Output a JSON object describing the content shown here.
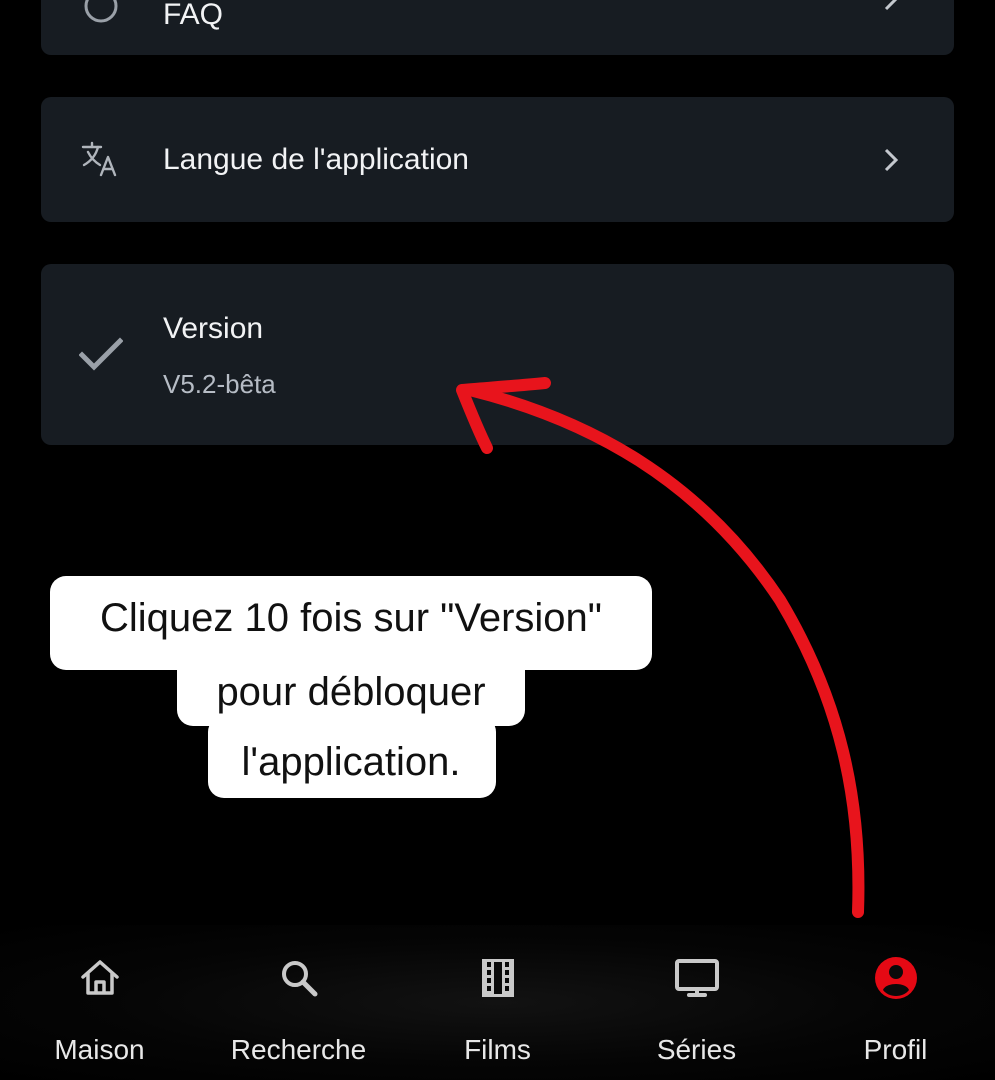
{
  "settings": {
    "faq": {
      "title": "FAQ"
    },
    "language": {
      "title": "Langue de l'application"
    },
    "version": {
      "title": "Version",
      "value": "V5.2-bêta"
    }
  },
  "annotation": {
    "lines": [
      "Cliquez 10 fois sur \"Version\"",
      "pour débloquer",
      "l'application."
    ],
    "arrow_color": "#e8141c"
  },
  "bottom_nav": {
    "items": [
      {
        "label": "Maison",
        "icon": "home-icon"
      },
      {
        "label": "Recherche",
        "icon": "search-icon"
      },
      {
        "label": "Films",
        "icon": "film-icon"
      },
      {
        "label": "Séries",
        "icon": "tv-icon"
      },
      {
        "label": "Profil",
        "icon": "account-circle-icon",
        "active": true
      }
    ],
    "active_color": "#e50914"
  }
}
